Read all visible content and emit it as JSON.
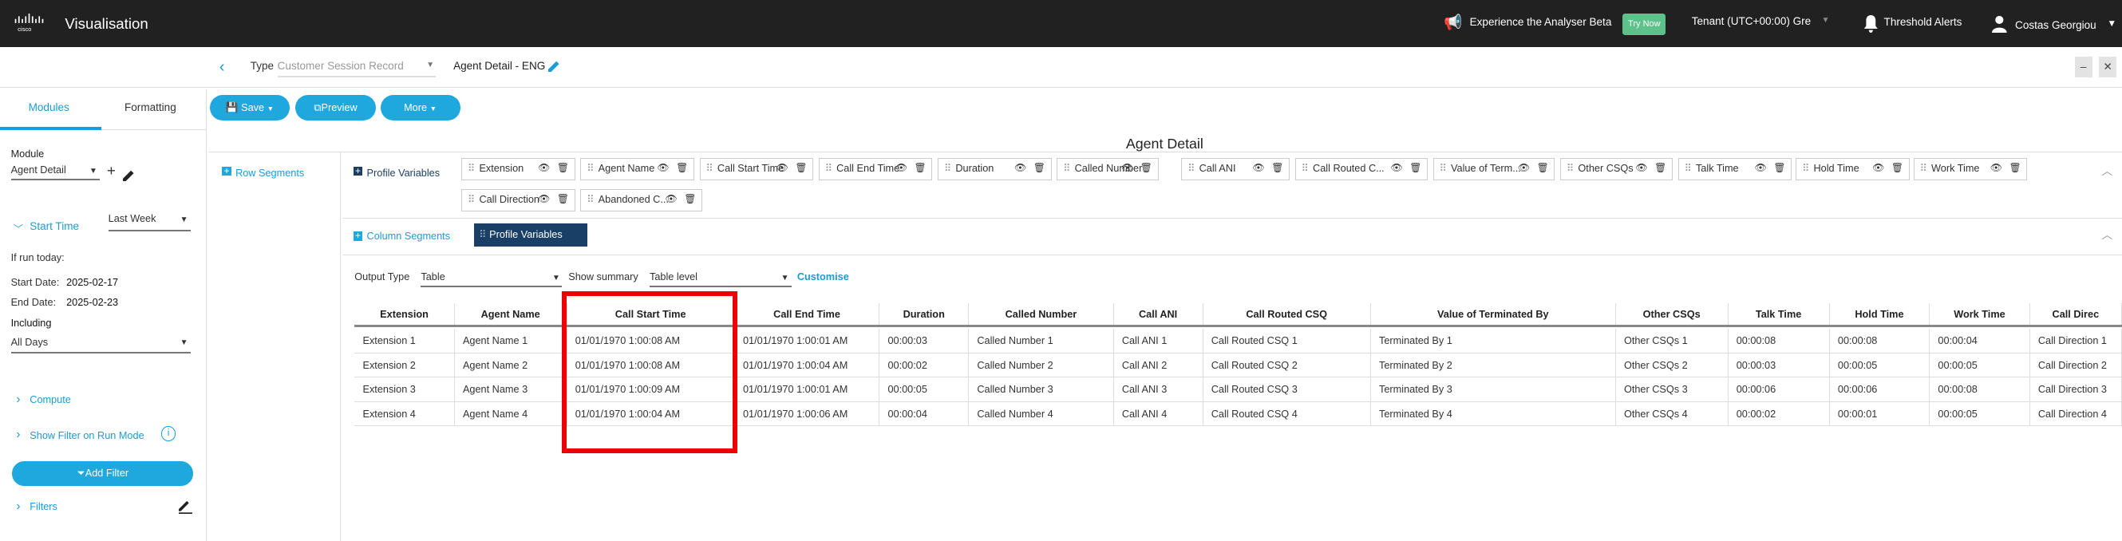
{
  "topbar": {
    "app_title": "Visualisation",
    "beta_text": "Experience the Analyser Beta",
    "try_now": "Try Now",
    "tenant": "Tenant (UTC+00:00) Gre",
    "threshold_alerts": "Threshold Alerts",
    "user": "Costas Georgiou"
  },
  "subbar": {
    "type_label": "Type",
    "type_value": "Customer Session Record",
    "report_name": "Agent Detail - ENG",
    "minimize": "‒",
    "close": "✕"
  },
  "left_panel": {
    "tabs": [
      "Modules",
      "Formatting"
    ],
    "module_label": "Module",
    "module_value": "Agent Detail",
    "start_time_label": "Start Time",
    "start_time_value": "Last Week",
    "if_run_today": "If run today:",
    "start_date_label": "Start Date:",
    "start_date": "2025-02-17",
    "end_date_label": "End Date:",
    "end_date": "2025-02-23",
    "including_label": "Including",
    "including_value": "All Days",
    "compute": "Compute",
    "show_filter": "Show Filter on Run Mode",
    "add_filter": "Add Filter",
    "filters": "Filters"
  },
  "toolbar": {
    "save": "Save",
    "preview": "Preview",
    "more": "More"
  },
  "main": {
    "title": "Agent Detail",
    "row_segments": "Row Segments",
    "profile_variables": "Profile Variables",
    "column_segments": "Column Segments",
    "column_chip": "Profile Variables",
    "output_type_label": "Output Type",
    "output_type_value": "Table",
    "show_summary_label": "Show summary",
    "show_summary_value": "Table level",
    "customise": "Customise",
    "variables": [
      "Extension",
      "Agent Name",
      "Call Start Time",
      "Call End Time",
      "Duration",
      "Called Number",
      "Call ANI",
      "Call Routed C...",
      "Value of Term...",
      "Other CSQs",
      "Talk Time",
      "Hold Time",
      "Work Time",
      "Call Direction",
      "Abandoned C..."
    ]
  },
  "table": {
    "headers": [
      "Extension",
      "Agent Name",
      "Call Start Time",
      "Call End Time",
      "Duration",
      "Called Number",
      "Call ANI",
      "Call Routed CSQ",
      "Value of Terminated By",
      "Other CSQs",
      "Talk Time",
      "Hold Time",
      "Work Time",
      "Call Direc"
    ],
    "rows": [
      [
        "Extension 1",
        "Agent Name 1",
        "01/01/1970 1:00:08 AM",
        "01/01/1970 1:00:01 AM",
        "00:00:03",
        "Called Number 1",
        "Call ANI 1",
        "Call Routed CSQ 1",
        "Terminated By 1",
        "Other CSQs 1",
        "00:00:08",
        "00:00:08",
        "00:00:04",
        "Call Direction 1"
      ],
      [
        "Extension 2",
        "Agent Name 2",
        "01/01/1970 1:00:08 AM",
        "01/01/1970 1:00:04 AM",
        "00:00:02",
        "Called Number 2",
        "Call ANI 2",
        "Call Routed CSQ 2",
        "Terminated By 2",
        "Other CSQs 2",
        "00:00:03",
        "00:00:05",
        "00:00:05",
        "Call Direction 2"
      ],
      [
        "Extension 3",
        "Agent Name 3",
        "01/01/1970 1:00:09 AM",
        "01/01/1970 1:00:01 AM",
        "00:00:05",
        "Called Number 3",
        "Call ANI 3",
        "Call Routed CSQ 3",
        "Terminated By 3",
        "Other CSQs 3",
        "00:00:06",
        "00:00:06",
        "00:00:08",
        "Call Direction 3"
      ],
      [
        "Extension 4",
        "Agent Name 4",
        "01/01/1970 1:00:04 AM",
        "01/01/1970 1:00:06 AM",
        "00:00:04",
        "Called Number 4",
        "Call ANI 4",
        "Call Routed CSQ 4",
        "Terminated By 4",
        "Other CSQs 4",
        "00:00:02",
        "00:00:01",
        "00:00:05",
        "Call Direction 4"
      ]
    ]
  },
  "colors": {
    "accent": "#1fa8dd",
    "topbar": "#212121",
    "highlight": "#e00000",
    "column_chip": "#1a3f66"
  }
}
